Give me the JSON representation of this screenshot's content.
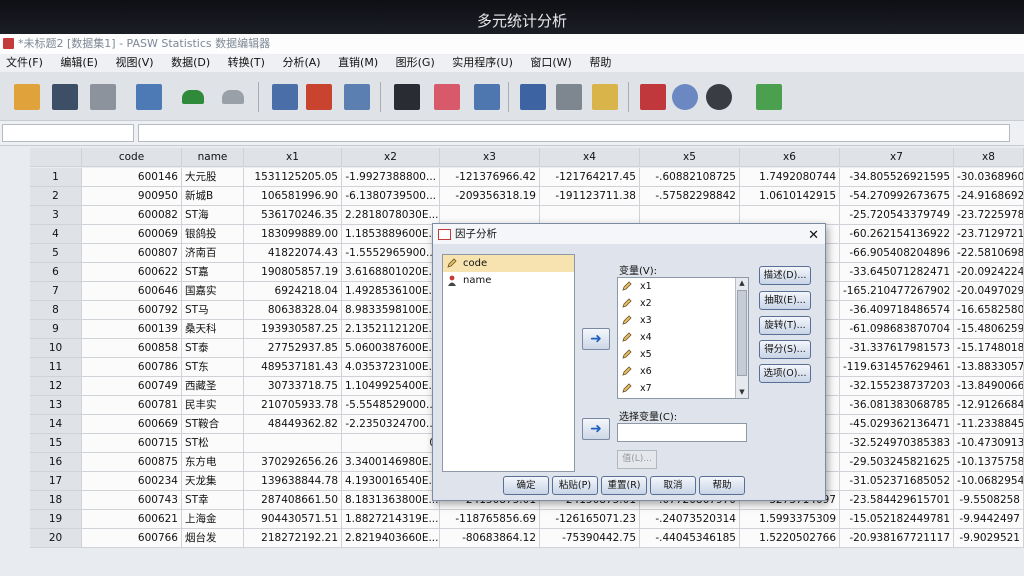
{
  "banner": {
    "title": "多元统计分析"
  },
  "window": {
    "title": "*未标题2 [数据集1] - PASW Statistics 数据编辑器"
  },
  "menu": [
    "文件(F)",
    "编辑(E)",
    "视图(V)",
    "数据(D)",
    "转换(T)",
    "分析(A)",
    "直销(M)",
    "图形(G)",
    "实用程序(U)",
    "窗口(W)",
    "帮助"
  ],
  "grid": {
    "headers": [
      "code",
      "name",
      "x1",
      "x2",
      "x3",
      "x4",
      "x5",
      "x6",
      "x7",
      "x8"
    ],
    "rows": [
      [
        "1",
        "600146",
        "大元股",
        "1531125205.05",
        "-1.9927388800...",
        "-121376966.42",
        "-121764217.45",
        "-.60882108725",
        "1.7492080744",
        "-34.805526921595",
        "-30.0368960"
      ],
      [
        "2",
        "900950",
        "新城B",
        "106581996.90",
        "-6.1380739500...",
        "-209356318.19",
        "-191123711.38",
        "-.57582298842",
        "1.0610142915",
        "-54.270992673675",
        "-24.9168692"
      ],
      [
        "3",
        "600082",
        "ST海",
        "536170246.35",
        "2.2818078030E...",
        "",
        "",
        "",
        "",
        "-25.720543379749",
        "-23.7225978"
      ],
      [
        "4",
        "600069",
        "银鸽投",
        "183099889.00",
        "1.1853889600E...",
        "",
        "",
        "",
        "",
        "-60.262154136922",
        "-23.7129721"
      ],
      [
        "5",
        "600807",
        "济南百",
        "41822074.43",
        "-1.5552965900...",
        "",
        "",
        "",
        "",
        "-66.905408204896",
        "-22.5810698"
      ],
      [
        "6",
        "600622",
        "ST嘉",
        "190805857.19",
        "3.6168801020E...",
        "",
        "",
        "",
        "",
        "-33.645071282471",
        "-20.0924224"
      ],
      [
        "7",
        "600646",
        "国嘉实",
        "6924218.04",
        "1.4928536100E...",
        "",
        "",
        "",
        "",
        "-165.210477267902",
        "-20.0497029"
      ],
      [
        "8",
        "600792",
        "ST马",
        "80638328.04",
        "8.9833598100E...",
        "",
        "",
        "",
        "",
        "-36.409718486574",
        "-16.6582580"
      ],
      [
        "9",
        "600139",
        "桑天科",
        "193930587.25",
        "2.1352112120E...",
        "",
        "",
        "",
        "",
        "-61.098683870704",
        "-15.4806259"
      ],
      [
        "10",
        "600858",
        "ST泰",
        "27752937.85",
        "5.0600387600E...",
        "",
        "",
        "",
        "",
        "-31.337617981573",
        "-15.1748018"
      ],
      [
        "11",
        "600786",
        "ST东",
        "489537181.43",
        "4.0353723100E...",
        "",
        "",
        "",
        "",
        "-119.631457629461",
        "-13.8833057"
      ],
      [
        "12",
        "600749",
        "西藏圣",
        "30733718.75",
        "1.1049925400E...",
        "",
        "",
        "",
        "",
        "-32.155238737203",
        "-13.8490066"
      ],
      [
        "13",
        "600781",
        "民丰实",
        "210705933.78",
        "-5.5548529000...",
        "",
        "",
        "",
        "",
        "-36.081383068785",
        "-12.9126684"
      ],
      [
        "14",
        "600669",
        "ST鞍合",
        "48449362.82",
        "-2.2350324700...",
        "",
        "",
        "",
        "",
        "-45.029362136471",
        "-11.2338845"
      ],
      [
        "15",
        "600715",
        "ST松",
        "",
        "0",
        "",
        "",
        "",
        "",
        "-32.524970385383",
        "-10.4730913"
      ],
      [
        "16",
        "600875",
        "东方电",
        "370292656.26",
        "3.3400146980E...",
        "",
        "",
        "",
        "",
        "-29.503245821625",
        "-10.1375758"
      ],
      [
        "17",
        "600234",
        "天龙集",
        "139638844.78",
        "4.1930016540E...",
        "",
        "",
        "",
        "",
        "-31.052371685052",
        "-10.0682954"
      ],
      [
        "18",
        "600743",
        "ST幸",
        "287408661.50",
        "8.1831363800E...",
        "-24150875.01",
        "-24150875.01",
        "-.07720867970",
        "3273714097",
        "-23.584429615701",
        "-9.5508258"
      ],
      [
        "19",
        "600621",
        "上海金",
        "904430571.51",
        "1.8827214319E...",
        "-118765856.69",
        "-126165071.23",
        "-.24073520314",
        "1.5993375309",
        "-15.052182449781",
        "-9.9442497"
      ],
      [
        "20",
        "600766",
        "烟台发",
        "218272192.21",
        "2.8219403660E...",
        "-80683864.12",
        "-75390442.75",
        "-.44045346185",
        "1.5220502766",
        "-20.938167721117",
        "-9.9029521"
      ]
    ]
  },
  "dialog": {
    "title": "因子分析",
    "close": "✕",
    "source_items": [
      "code",
      "name"
    ],
    "variables_label": "变量(V):",
    "variables": [
      "x1",
      "x2",
      "x3",
      "x4",
      "x5",
      "x6",
      "x7"
    ],
    "selection_label": "选择变量(C):",
    "cases_button": "值(L)...",
    "side_buttons": [
      "描述(D)...",
      "抽取(E)...",
      "旋转(T)...",
      "得分(S)...",
      "选项(O)..."
    ],
    "bottom_buttons": [
      "确定",
      "粘贴(P)",
      "重置(R)",
      "取消",
      "帮助"
    ],
    "arrow": "➜"
  }
}
